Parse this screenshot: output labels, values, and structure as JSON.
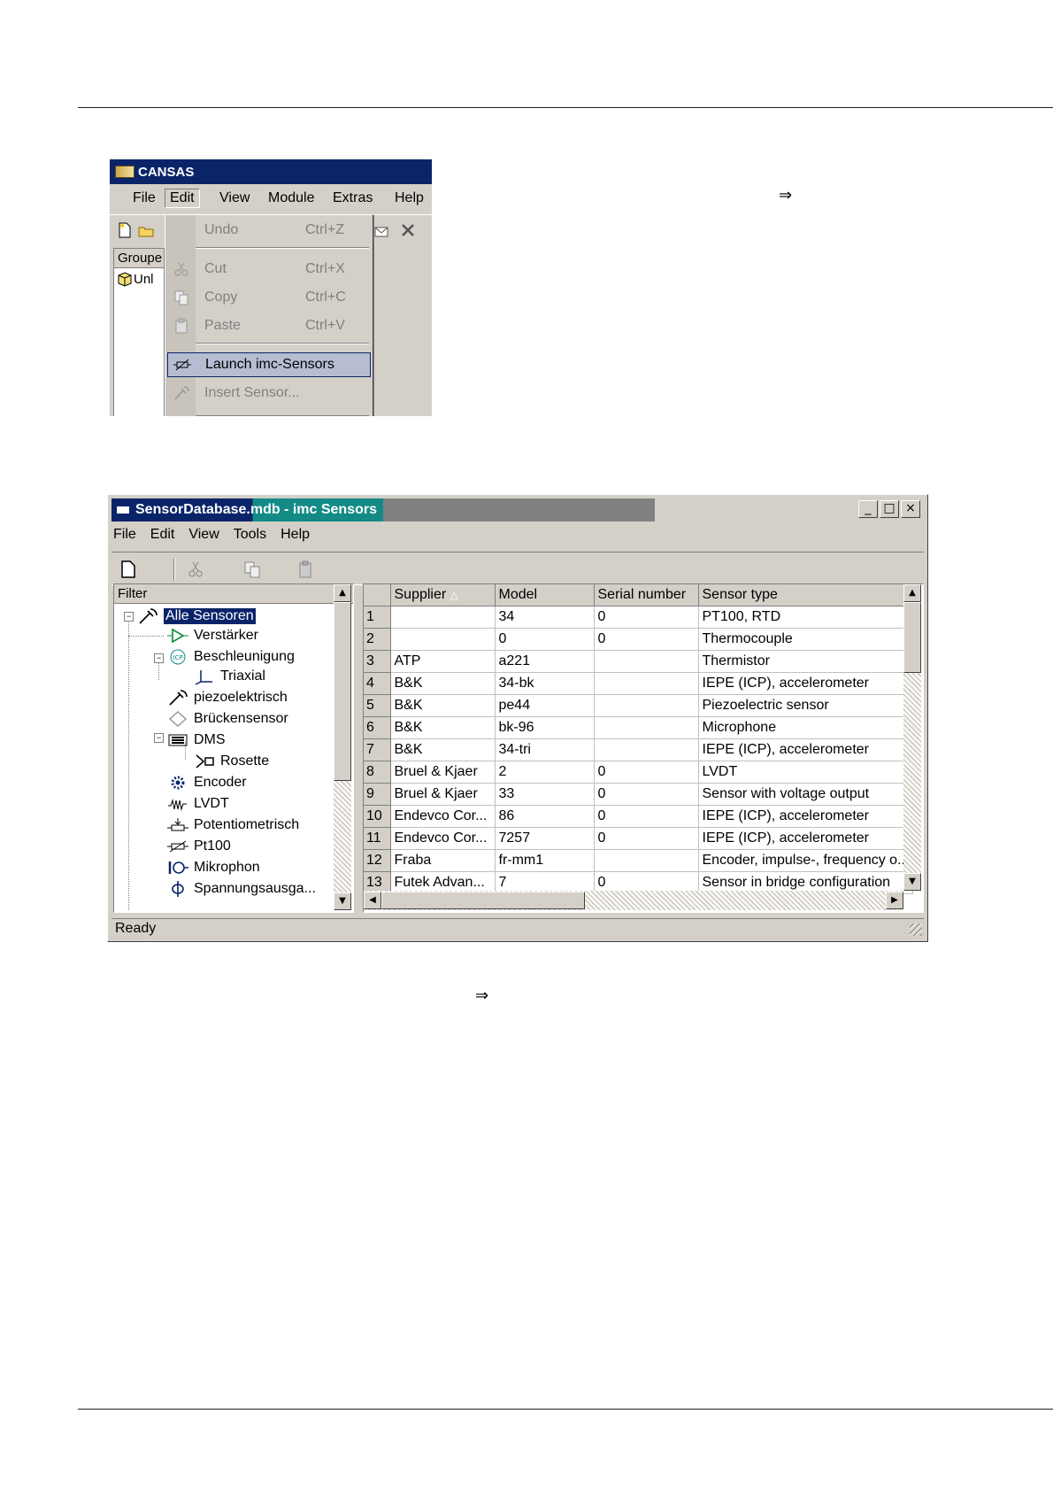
{
  "cansas": {
    "title": "CANSAS",
    "menu": [
      "File",
      "Edit",
      "View",
      "Module",
      "Extras",
      "Help"
    ],
    "pane_header": "Groupe",
    "pane_item": "Unl",
    "edit_menu": [
      {
        "label": "Undo",
        "shortcut": "Ctrl+Z"
      },
      {
        "label": "Cut",
        "shortcut": "Ctrl+X"
      },
      {
        "label": "Copy",
        "shortcut": "Ctrl+C"
      },
      {
        "label": "Paste",
        "shortcut": "Ctrl+V"
      },
      {
        "label": "Launch imc-Sensors",
        "shortcut": ""
      },
      {
        "label": "Insert Sensor...",
        "shortcut": ""
      }
    ]
  },
  "arrows": {
    "first": "⇒",
    "second": "⇒"
  },
  "sensors": {
    "title_prefix": "SensorDatabase",
    "title_suffix": ".mdb - imc Sensors",
    "window_buttons": [
      "_",
      "□",
      "×"
    ],
    "menu": [
      "File",
      "Edit",
      "View",
      "Tools",
      "Help"
    ],
    "filter_header": "Filter",
    "tree": [
      {
        "label": "Alle Sensoren",
        "icon": "sensor-probe-icon",
        "selected": true
      },
      {
        "label": "Verstärker",
        "icon": "amplifier-icon"
      },
      {
        "label": "Beschleunigung",
        "icon": "icp-icon"
      },
      {
        "label": "Triaxial",
        "icon": "triaxial-icon"
      },
      {
        "label": "piezoelektrisch",
        "icon": "piezo-probe-icon"
      },
      {
        "label": "Brückensensor",
        "icon": "bridge-icon"
      },
      {
        "label": "DMS",
        "icon": "strain-gauge-icon"
      },
      {
        "label": "Rosette",
        "icon": "rosette-icon"
      },
      {
        "label": "Encoder",
        "icon": "encoder-gear-icon"
      },
      {
        "label": "LVDT",
        "icon": "lvdt-coil-icon"
      },
      {
        "label": "Potentiometrisch",
        "icon": "potentiometer-icon"
      },
      {
        "label": "Pt100",
        "icon": "resistor-icon"
      },
      {
        "label": "Mikrophon",
        "icon": "microphone-icon"
      },
      {
        "label": "Spannungsausga...",
        "icon": "phi-icon"
      }
    ],
    "columns": [
      "Supplier",
      "Model",
      "Serial number",
      "Sensor type"
    ],
    "rows": [
      [
        "1",
        "",
        "34",
        "0",
        "PT100, RTD"
      ],
      [
        "2",
        "",
        "0",
        "0",
        "Thermocouple"
      ],
      [
        "3",
        "ATP",
        "a221",
        "",
        "Thermistor"
      ],
      [
        "4",
        "B&K",
        "34-bk",
        "",
        "IEPE (ICP), accelerometer"
      ],
      [
        "5",
        "B&K",
        "pe44",
        "",
        "Piezoelectric sensor"
      ],
      [
        "6",
        "B&K",
        "bk-96",
        "",
        "Microphone"
      ],
      [
        "7",
        "B&K",
        "34-tri",
        "",
        "IEPE (ICP), accelerometer"
      ],
      [
        "8",
        "Bruel & Kjaer",
        "2",
        "0",
        "LVDT"
      ],
      [
        "9",
        "Bruel & Kjaer",
        "33",
        "0",
        "Sensor with voltage output"
      ],
      [
        "10",
        "Endevco Cor...",
        "86",
        "0",
        "IEPE (ICP), accelerometer"
      ],
      [
        "11",
        "Endevco Cor...",
        "7257",
        "0",
        "IEPE (ICP), accelerometer"
      ],
      [
        "12",
        "Fraba",
        "fr-mm1",
        "",
        "Encoder, impulse-, frequency o..."
      ],
      [
        "13",
        "Futek Advan...",
        "7",
        "0",
        "Sensor in bridge configuration"
      ]
    ],
    "status": "Ready"
  }
}
